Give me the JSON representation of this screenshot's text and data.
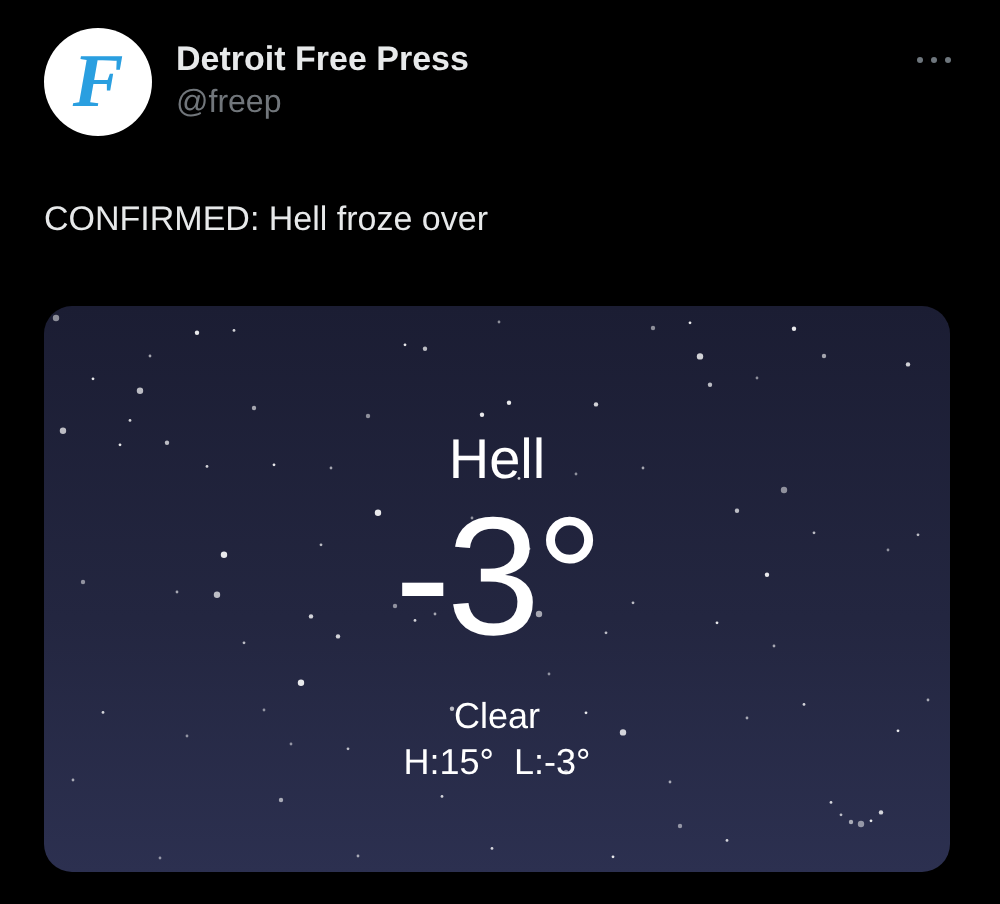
{
  "post": {
    "author": {
      "name": "Detroit Free Press",
      "handle": "@freep",
      "logo_letter": "F"
    },
    "text": "CONFIRMED: Hell froze over",
    "weather_card": {
      "location": "Hell",
      "temperature": "-3°",
      "condition": "Clear",
      "high_low": "H:15°  L:-3°"
    }
  }
}
